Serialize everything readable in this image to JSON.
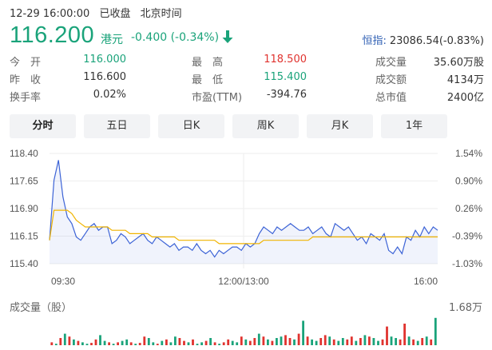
{
  "header": {
    "date": "12-29 16:00:00",
    "status": "已收盘",
    "timezone": "北京时间"
  },
  "quote": {
    "price": "116.200",
    "unit": "港元",
    "change": "-0.400 (-0.34%)",
    "index_label": "恒指:",
    "index_value": "23086.54(-0.83%)"
  },
  "stats": {
    "rows": [
      {
        "l1": "今　开",
        "v1": "116.000",
        "l2": "最　高",
        "v2": "118.500",
        "l3": "成交量",
        "v3": "35.60万股"
      },
      {
        "l1": "昨　收",
        "v1": "116.600",
        "l2": "最　低",
        "v2": "115.400",
        "l3": "成交额",
        "v3": "4134万"
      },
      {
        "l1": "换手率",
        "v1": "0.02%",
        "l2": "市盈(TTM)",
        "v2": "-394.76",
        "l3": "总市值",
        "v3": "2400亿"
      }
    ]
  },
  "tabs": [
    "分时",
    "五日",
    "日K",
    "周K",
    "月K",
    "1年"
  ],
  "colors": {
    "up": "#e0332f",
    "down": "#1aa37a",
    "price_line": "#3c63d6",
    "avg_line": "#f0b400",
    "index_blue": "#2f5fb3"
  },
  "chart_data": {
    "type": "line",
    "y_ticks": [
      "118.40",
      "117.65",
      "116.90",
      "116.15",
      "115.40"
    ],
    "pct_ticks": [
      "1.54%",
      "0.90%",
      "0.26%",
      "-0.39%",
      "-1.03%"
    ],
    "ylim": [
      115.2,
      118.5
    ],
    "x_ticks": [
      "09:30",
      "12:00/13:00",
      "16:00"
    ],
    "series": [
      {
        "values": [
          115.9,
          117.7,
          118.3,
          117.2,
          116.6,
          116.4,
          116.0,
          115.9,
          116.1,
          116.3,
          116.4,
          116.2,
          116.3,
          116.3,
          115.8,
          115.9,
          116.1,
          116.0,
          115.8,
          115.9,
          116.0,
          116.1,
          115.9,
          115.8,
          116.0,
          115.9,
          115.8,
          115.7,
          115.8,
          115.6,
          115.7,
          115.7,
          115.6,
          115.8,
          115.6,
          115.5,
          115.6,
          115.4,
          115.6,
          115.5,
          115.6,
          115.7,
          115.7,
          115.6,
          115.8,
          115.7,
          115.8,
          116.1,
          116.3,
          116.2,
          116.1,
          116.3,
          116.2,
          116.3,
          116.4,
          116.3,
          116.2,
          116.2,
          116.3,
          116.1,
          116.2,
          116.3,
          116.1,
          116.0,
          116.4,
          116.3,
          116.2,
          116.3,
          116.1,
          115.9,
          116.0,
          115.8,
          116.1,
          116.0,
          115.9,
          116.1,
          115.6,
          115.5,
          115.7,
          115.5,
          116.0,
          115.9,
          116.2,
          116.0,
          116.3,
          116.1,
          116.3,
          116.2
        ]
      },
      {
        "values": [
          115.9,
          116.8,
          116.8,
          116.8,
          116.8,
          116.7,
          116.5,
          116.4,
          116.3,
          116.3,
          116.3,
          116.3,
          116.3,
          116.3,
          116.2,
          116.2,
          116.2,
          116.2,
          116.1,
          116.1,
          116.1,
          116.1,
          116.1,
          116.0,
          116.0,
          116.0,
          116.0,
          116.0,
          116.0,
          115.9,
          115.9,
          115.9,
          115.9,
          115.9,
          115.9,
          115.9,
          115.9,
          115.9,
          115.8,
          115.8,
          115.8,
          115.8,
          115.8,
          115.8,
          115.8,
          115.8,
          115.8,
          115.8,
          115.9,
          115.9,
          115.9,
          115.9,
          115.9,
          115.9,
          115.9,
          115.9,
          115.9,
          115.9,
          115.9,
          116.0,
          116.0,
          116.0,
          116.0,
          116.0,
          116.0,
          116.0,
          116.0,
          116.0,
          116.0,
          116.0,
          116.0,
          116.0,
          116.0,
          116.0,
          116.0,
          116.0,
          116.0,
          116.0,
          116.0,
          116.0,
          116.0,
          116.0,
          116.0,
          116.0,
          116.0,
          116.0,
          116.0,
          116.0
        ]
      }
    ],
    "volume": {
      "ylabel": "成交量（股）",
      "max_label": "1.68万",
      "values": [
        0.1,
        0.05,
        0.25,
        0.4,
        0.3,
        0.2,
        0.15,
        0.1,
        0.05,
        0.08,
        0.2,
        0.35,
        0.15,
        0.1,
        0.05,
        0.1,
        0.15,
        0.2,
        0.1,
        0.05,
        0.08,
        0.3,
        0.25,
        0.1,
        0.05,
        0.15,
        0.2,
        0.1,
        0.3,
        0.25,
        0.15,
        0.1,
        0.2,
        0.05,
        0.1,
        0.15,
        0.25,
        0.1,
        0.05,
        0.1,
        0.2,
        0.15,
        0.1,
        0.3,
        0.2,
        0.15,
        0.25,
        0.4,
        0.3,
        0.2,
        0.15,
        0.25,
        0.3,
        0.35,
        0.25,
        0.2,
        0.4,
        0.85,
        0.3,
        0.2,
        0.15,
        0.25,
        0.35,
        0.3,
        0.2,
        0.15,
        0.25,
        0.2,
        0.3,
        0.15,
        0.25,
        0.35,
        0.3,
        0.25,
        0.15,
        0.2,
        0.65,
        0.3,
        0.25,
        0.2,
        0.75,
        0.3,
        0.2,
        0.15,
        0.25,
        0.3,
        0.2,
        0.95
      ],
      "up": [
        1,
        0,
        1,
        0,
        1,
        0,
        1,
        0,
        0,
        1,
        1,
        0,
        0,
        1,
        0,
        1,
        0,
        0,
        1,
        0,
        1,
        1,
        0,
        0,
        1,
        0,
        1,
        0,
        0,
        1,
        1,
        0,
        1,
        0,
        0,
        1,
        0,
        1,
        0,
        1,
        1,
        0,
        0,
        1,
        0,
        1,
        1,
        0,
        1,
        0,
        1,
        0,
        0,
        1,
        1,
        0,
        1,
        0,
        1,
        0,
        0,
        1,
        1,
        0,
        1,
        0,
        0,
        1,
        1,
        0,
        1,
        0,
        1,
        0,
        0,
        1,
        1,
        0,
        0,
        1,
        1,
        0,
        1,
        0,
        1,
        0,
        1,
        0
      ]
    }
  }
}
